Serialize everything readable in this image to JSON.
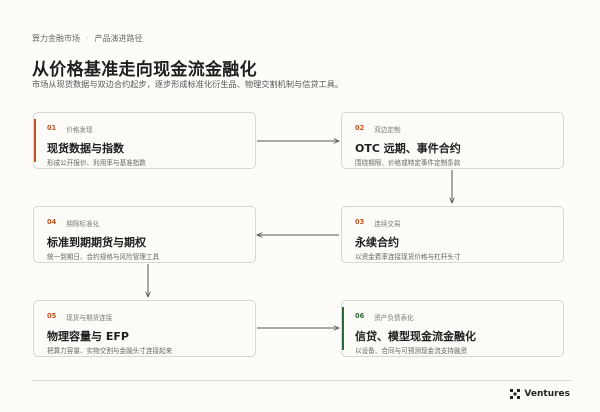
{
  "breadcrumb": {
    "section": "算力金融市场",
    "separator": "·",
    "page": "产品演进路径"
  },
  "title": "从价格基准走向现金流金融化",
  "subtitle": "市场从现货数据与双边合约起步，逐步形成标准化衍生品、物理交割机制与信贷工具。",
  "cards": [
    {
      "number": "01",
      "category": "价格发现",
      "name": "现货数据与指数",
      "desc": "形成公开报价、利用率与基准指数"
    },
    {
      "number": "02",
      "category": "双边定制",
      "name": "OTC 远期、事件合约",
      "desc": "围绕期限、价格或特定事件定制条款"
    },
    {
      "number": "03",
      "category": "连续交易",
      "name": "永续合约",
      "desc": "以资金费率连接现货价格与杠杆头寸"
    },
    {
      "number": "04",
      "category": "期限标准化",
      "name": "标准到期期货与期权",
      "desc": "统一到期日、合约规格与风险管理工具"
    },
    {
      "number": "05",
      "category": "现货与期货连接",
      "name": "物理容量与 EFP",
      "desc": "把算力容量、实物交割与金融头寸连接起来"
    },
    {
      "number": "06",
      "category": "资产负债表化",
      "name": "信贷、模型现金流金融化",
      "desc": "以设备、合同与可预测现金流支持融资"
    }
  ],
  "brand": {
    "name": "Ventures"
  },
  "colors": {
    "accent_orange": "#c2521f",
    "accent_green": "#2f6b3a",
    "arrow": "#555555"
  }
}
